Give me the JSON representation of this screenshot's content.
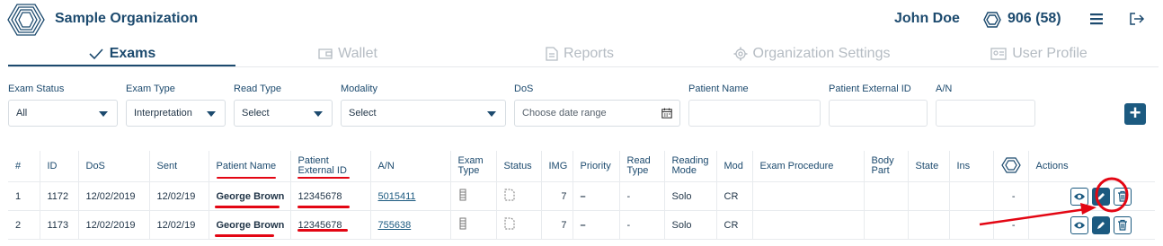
{
  "header": {
    "org_name": "Sample Organization",
    "user_name": "John Doe",
    "credits": "906 (58)",
    "icons": [
      "logo-icon",
      "credits-icon",
      "menu-icon",
      "logout-icon"
    ]
  },
  "tabs": [
    {
      "label": "Exams",
      "icon": "checkmark-icon",
      "active": true
    },
    {
      "label": "Wallet",
      "icon": "wallet-icon",
      "active": false
    },
    {
      "label": "Reports",
      "icon": "document-icon",
      "active": false
    },
    {
      "label": "Organization Settings",
      "icon": "gear-icon",
      "active": false
    },
    {
      "label": "User Profile",
      "icon": "id-card-icon",
      "active": false
    }
  ],
  "filters": {
    "exam_status": {
      "label": "Exam Status",
      "value": "All"
    },
    "exam_type": {
      "label": "Exam Type",
      "value": "Interpretation"
    },
    "read_type": {
      "label": "Read Type",
      "value": "Select"
    },
    "modality": {
      "label": "Modality",
      "value": "Select"
    },
    "dos": {
      "label": "DoS",
      "placeholder": "Choose date range"
    },
    "patient_name": {
      "label": "Patient Name",
      "value": ""
    },
    "patient_external_id": {
      "label": "Patient External ID",
      "value": ""
    },
    "an": {
      "label": "A/N",
      "value": ""
    },
    "add_label": "+"
  },
  "table": {
    "headers": {
      "num": "#",
      "id": "ID",
      "dos": "DoS",
      "sent": "Sent",
      "patient_name": "Patient Name",
      "patient_ext_1": "Patient",
      "patient_ext_2": "External ID",
      "an": "A/N",
      "exam_type_1": "Exam",
      "exam_type_2": "Type",
      "status": "Status",
      "img": "IMG",
      "priority": "Priority",
      "read_type_1": "Read",
      "read_type_2": "Type",
      "reading_mode_1": "Reading",
      "reading_mode_2": "Mode",
      "mod": "Mod",
      "exam_procedure": "Exam Procedure",
      "body_part_1": "Body",
      "body_part_2": "Part",
      "state": "State",
      "ins": "Ins",
      "actions": "Actions"
    },
    "rows": [
      {
        "num": "1",
        "id": "1172",
        "dos": "12/02/2019",
        "sent": "12/02/19",
        "patient_name": "George Brown",
        "patient_external_id": "12345678",
        "an": "5015411",
        "img": "7",
        "priority": "–",
        "read_type": "-",
        "reading_mode": "Solo",
        "mod": "CR",
        "exam_procedure": "",
        "body_part": "",
        "state": "",
        "ins": "",
        "org_col": "-"
      },
      {
        "num": "2",
        "id": "1173",
        "dos": "12/02/2019",
        "sent": "12/02/19",
        "patient_name": "George Brown",
        "patient_external_id": "12345678",
        "an": "755638",
        "img": "7",
        "priority": "–",
        "read_type": "-",
        "reading_mode": "Solo",
        "mod": "CR",
        "exam_procedure": "",
        "body_part": "",
        "state": "",
        "ins": "",
        "org_col": "-"
      }
    ]
  },
  "colors": {
    "brand": "#1c4a6e",
    "button": "#1c5a80",
    "annotation": "#e30613",
    "inactive_tab": "#b5bcc3"
  }
}
